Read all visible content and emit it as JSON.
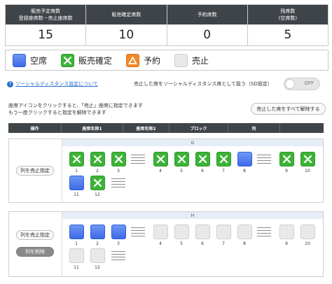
{
  "summary": [
    {
      "label1": "販売予定席数",
      "label2": "登録座席数－売止座席数",
      "value": "15"
    },
    {
      "label1": "販売確定席数",
      "label2": "",
      "value": "10"
    },
    {
      "label1": "予約席数",
      "label2": "",
      "value": "0"
    },
    {
      "label1": "残席数",
      "label2": "(空席数)",
      "value": "5"
    }
  ],
  "legend": [
    {
      "icon": "empty-seat-icon",
      "label": "空席"
    },
    {
      "icon": "sold-seat-icon",
      "label": "販売確定"
    },
    {
      "icon": "reserved-seat-icon",
      "label": "予約"
    },
    {
      "icon": "stopped-seat-icon",
      "label": "売止"
    }
  ],
  "colors": {
    "empty": "#4a78ec",
    "sold": "#3db338",
    "reserved": "#f08a2a",
    "stopped": "#e9e9e9",
    "header": "#3f4449"
  },
  "social_distance": {
    "link_text": "ソーシャルディスタンス設定について",
    "label": "売止した席をソーシャルディスタンス席として扱う（SD設定）",
    "toggle_state": "OFF"
  },
  "instructions": {
    "line1": "座席アイコンをクリックすると、「売止」座席に指定できます",
    "line2": "もう一度クリックすると指定を解除できます"
  },
  "release_all_button": "売止した席をすべて解除する",
  "columns": [
    "操作",
    "座席名称1",
    "座席名称2",
    "ブロック",
    "列"
  ],
  "blocks": [
    {
      "row_label": "G",
      "buttons": [
        "列を売止指定"
      ],
      "seats": [
        {
          "num": "1",
          "state": "sold"
        },
        {
          "num": "2",
          "state": "sold"
        },
        {
          "num": "3",
          "state": "sold"
        },
        {
          "num": "4",
          "state": "sold"
        },
        {
          "num": "5",
          "state": "sold"
        },
        {
          "num": "6",
          "state": "sold"
        },
        {
          "num": "7",
          "state": "sold"
        },
        {
          "num": "8",
          "state": "empty"
        },
        {
          "num": "9",
          "state": "sold"
        },
        {
          "num": "10",
          "state": "sold"
        },
        {
          "num": "11",
          "state": "empty"
        },
        {
          "num": "12",
          "state": "sold"
        }
      ]
    },
    {
      "row_label": "H",
      "buttons": [
        "列を売止指定",
        "列を削除"
      ],
      "seats": [
        {
          "num": "1",
          "state": "empty"
        },
        {
          "num": "2",
          "state": "empty"
        },
        {
          "num": "3",
          "state": "empty"
        },
        {
          "num": "4",
          "state": "stopped"
        },
        {
          "num": "5",
          "state": "stopped"
        },
        {
          "num": "6",
          "state": "stopped"
        },
        {
          "num": "7",
          "state": "stopped"
        },
        {
          "num": "8",
          "state": "stopped"
        },
        {
          "num": "9",
          "state": "stopped"
        },
        {
          "num": "10",
          "state": "stopped"
        },
        {
          "num": "11",
          "state": "stopped"
        },
        {
          "num": "12",
          "state": "stopped"
        }
      ]
    }
  ]
}
